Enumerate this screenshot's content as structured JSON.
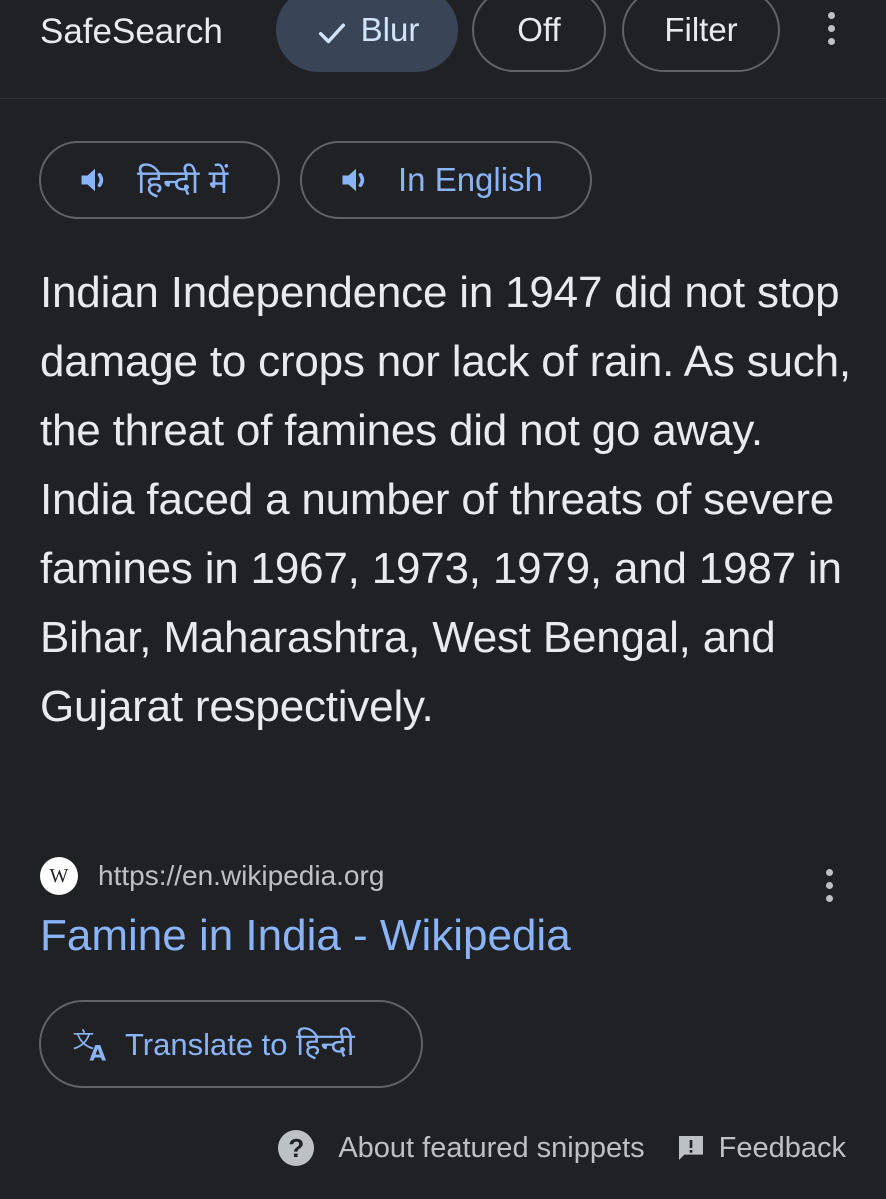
{
  "safesearch": {
    "label": "SafeSearch",
    "options": [
      {
        "label": "Blur",
        "selected": true
      },
      {
        "label": "Off",
        "selected": false
      },
      {
        "label": "Filter",
        "selected": false
      }
    ],
    "more_icon": "more-vert-icon"
  },
  "listen": {
    "hindi_label": "हिन्दी में",
    "english_label": "In English",
    "icon": "speaker-icon"
  },
  "snippet": {
    "text": "Indian Independence in 1947 did not stop damage to crops nor lack of rain. As such, the threat of famines did not go away. India faced a number of threats of severe famines in 1967, 1973, 1979, and 1987 in Bihar, Maharashtra, West Bengal, and Gujarat respectively."
  },
  "source": {
    "favicon_letter": "W",
    "url": "https://en.wikipedia.org",
    "title": "Famine in India - Wikipedia"
  },
  "translate": {
    "label": "Translate to हिन्दी"
  },
  "footer": {
    "about_label": "About featured snippets",
    "feedback_label": "Feedback"
  },
  "colors": {
    "background": "#202124",
    "link": "#8ab4f8",
    "selected_chip": "#394457",
    "text": "#e8eaed"
  }
}
